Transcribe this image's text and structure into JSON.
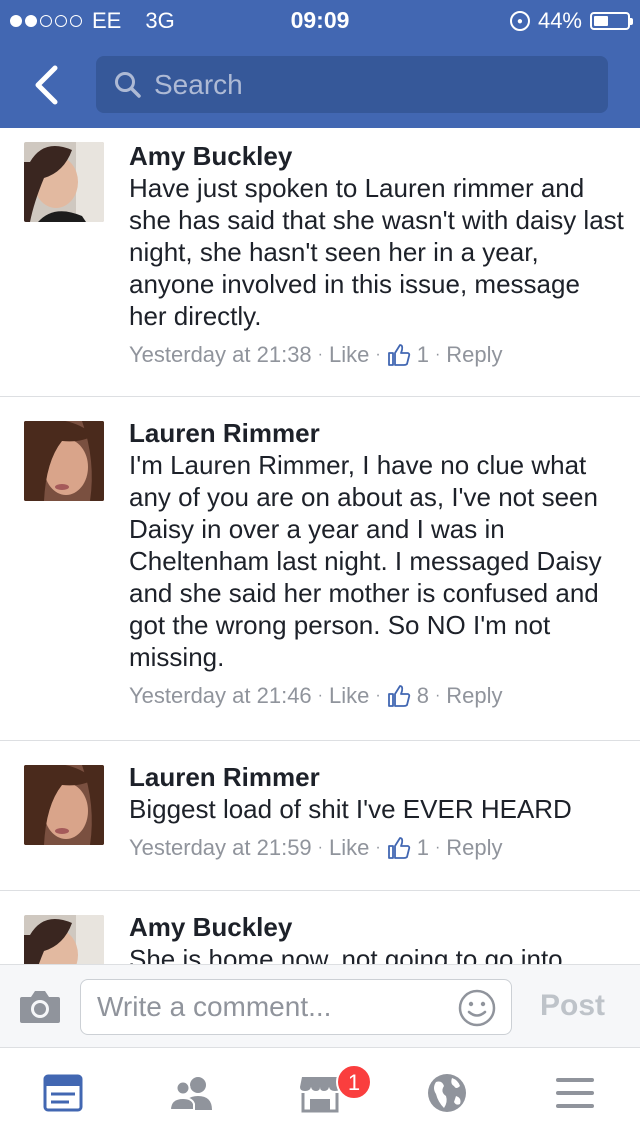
{
  "status_bar": {
    "carrier": "EE",
    "network": "3G",
    "time": "09:09",
    "battery": "44%",
    "battery_level": 0.44,
    "signal_bars": 2
  },
  "header": {
    "back_icon": "chevron-left-icon",
    "search_placeholder": "Search"
  },
  "comments": [
    {
      "author": "Amy Buckley",
      "text": "Have just spoken to Lauren rimmer and she has said that she wasn't with daisy last night, she hasn't seen her in a year, anyone involved in this issue, message her directly.",
      "time": "Yesterday at 21:38",
      "like_label": "Like",
      "like_count": "1",
      "reply_label": "Reply"
    },
    {
      "author": "Lauren Rimmer",
      "text": "I'm Lauren Rimmer, I have no clue what any of you are on about as, I've not seen Daisy in over a year and I was in Cheltenham last night. I messaged Daisy and she said her mother is confused and got the wrong person. So NO I'm not missing.",
      "time": "Yesterday at 21:46",
      "like_label": "Like",
      "like_count": "8",
      "reply_label": "Reply"
    },
    {
      "author": "Lauren Rimmer",
      "text": "Biggest load of shit I've EVER HEARD",
      "time": "Yesterday at 21:59",
      "like_label": "Like",
      "like_count": "1",
      "reply_label": "Reply"
    },
    {
      "author": "Amy Buckley",
      "text": "She is home now, not going to go into",
      "time": "",
      "like_label": "",
      "like_count": "",
      "reply_label": ""
    }
  ],
  "compose": {
    "placeholder": "Write a comment...",
    "post_label": "Post"
  },
  "tabs": [
    {
      "name": "news-feed",
      "icon": "news-feed-icon",
      "active": true
    },
    {
      "name": "friends",
      "icon": "friends-icon",
      "active": false
    },
    {
      "name": "marketplace",
      "icon": "marketplace-icon",
      "active": false
    },
    {
      "name": "notifications",
      "icon": "globe-icon",
      "active": false
    },
    {
      "name": "menu",
      "icon": "menu-icon",
      "active": false
    }
  ],
  "badge_count": "1",
  "colors": {
    "brand_blue": "#4267b2",
    "search_bg": "#365899",
    "meta_gray": "#90949c",
    "badge_red": "#fa3e3e"
  }
}
